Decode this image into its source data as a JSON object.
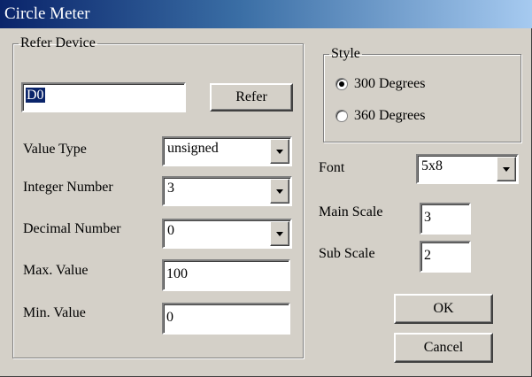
{
  "window": {
    "title": "Circle Meter"
  },
  "refer_device": {
    "group_label": "Refer Device",
    "device_value": "D0",
    "refer_button": "Refer",
    "value_type": {
      "label": "Value Type",
      "selected": "unsigned"
    },
    "integer_number": {
      "label": "Integer Number",
      "selected": "3"
    },
    "decimal_number": {
      "label": "Decimal Number",
      "selected": "0"
    },
    "max_value": {
      "label": "Max. Value",
      "value": "100"
    },
    "min_value": {
      "label": "Min. Value",
      "value": "0"
    }
  },
  "style": {
    "group_label": "Style",
    "options": [
      {
        "label": "300 Degrees",
        "checked": true
      },
      {
        "label": "360 Degrees",
        "checked": false
      }
    ]
  },
  "font": {
    "label": "Font",
    "selected": "5x8"
  },
  "main_scale": {
    "label": "Main Scale",
    "value": "3"
  },
  "sub_scale": {
    "label": "Sub Scale",
    "value": "2"
  },
  "buttons": {
    "ok": "OK",
    "cancel": "Cancel"
  },
  "colors": {
    "face": "#d4d0c8",
    "title_start": "#0a246a",
    "title_end": "#a6caf0",
    "selection": "#0a246a"
  }
}
